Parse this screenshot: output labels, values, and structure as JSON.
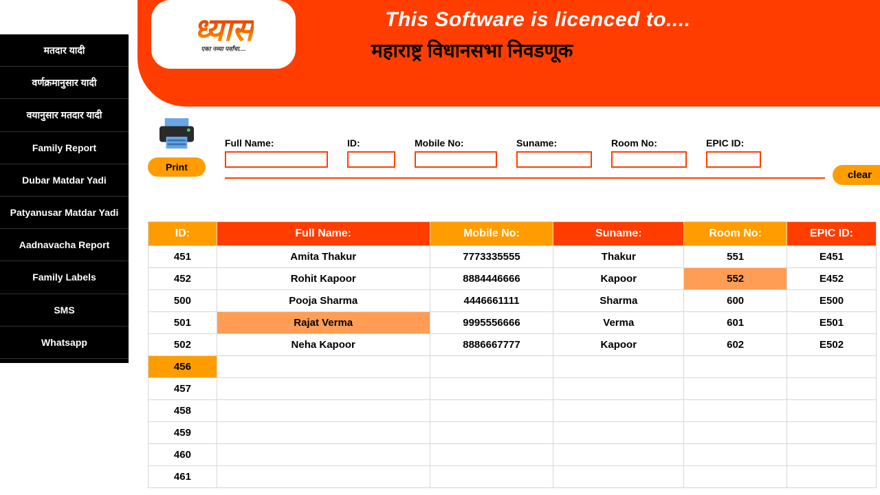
{
  "logo": {
    "text": "ध्यास",
    "sub": "एका नव्या पर्वांचा...."
  },
  "header": {
    "title": "This Software is licenced to....",
    "sub": "महाराष्ट्र विधानसभा निवडणूक"
  },
  "sidebar": {
    "items": [
      "मतदार यादी",
      "वर्णक्रमानुसार यादी",
      "वयानुसार मतदार यादी",
      "Family Report",
      "Dubar Matdar Yadi",
      "Patyanusar Matdar Yadi",
      "Aadnavacha Report",
      "Family Labels",
      "SMS",
      "Whatsapp"
    ]
  },
  "toolbar": {
    "print": "Print",
    "clear": "clear"
  },
  "filters": {
    "fullname_label": "Full Name:",
    "id_label": "ID:",
    "mobile_label": "Mobile No:",
    "suname_label": "Suname:",
    "room_label": "Room No:",
    "epic_label": "EPIC ID:"
  },
  "table": {
    "headers": {
      "id": "ID:",
      "fullname": "Full Name:",
      "mobile": "Mobile No:",
      "suname": "Suname:",
      "room": "Room No:",
      "epic": "EPIC ID:"
    },
    "rows": [
      {
        "id": "451",
        "name": "Amita Thakur",
        "mobile": "7773335555",
        "suname": "Thakur",
        "room": "551",
        "epic": "E451",
        "hl": ""
      },
      {
        "id": "452",
        "name": "Rohit Kapoor",
        "mobile": "8884446666",
        "suname": "Kapoor",
        "room": "552",
        "epic": "E452",
        "hl": "room"
      },
      {
        "id": "500",
        "name": "Pooja Sharma",
        "mobile": "4446661111",
        "suname": "Sharma",
        "room": "600",
        "epic": "E500",
        "hl": ""
      },
      {
        "id": "501",
        "name": "Rajat Verma",
        "mobile": "9995556666",
        "suname": "Verma",
        "room": "601",
        "epic": "E501",
        "hl": "name"
      },
      {
        "id": "502",
        "name": "Neha Kapoor",
        "mobile": "8886667777",
        "suname": "Kapoor",
        "room": "602",
        "epic": "E502",
        "hl": ""
      },
      {
        "id": "456",
        "name": "",
        "mobile": "",
        "suname": "",
        "room": "",
        "epic": "",
        "hl": "id"
      },
      {
        "id": "457",
        "name": "",
        "mobile": "",
        "suname": "",
        "room": "",
        "epic": "",
        "hl": ""
      },
      {
        "id": "458",
        "name": "",
        "mobile": "",
        "suname": "",
        "room": "",
        "epic": "",
        "hl": ""
      },
      {
        "id": "459",
        "name": "",
        "mobile": "",
        "suname": "",
        "room": "",
        "epic": "",
        "hl": ""
      },
      {
        "id": "460",
        "name": "",
        "mobile": "",
        "suname": "",
        "room": "",
        "epic": "",
        "hl": ""
      },
      {
        "id": "461",
        "name": "",
        "mobile": "",
        "suname": "",
        "room": "",
        "epic": "",
        "hl": ""
      }
    ]
  }
}
